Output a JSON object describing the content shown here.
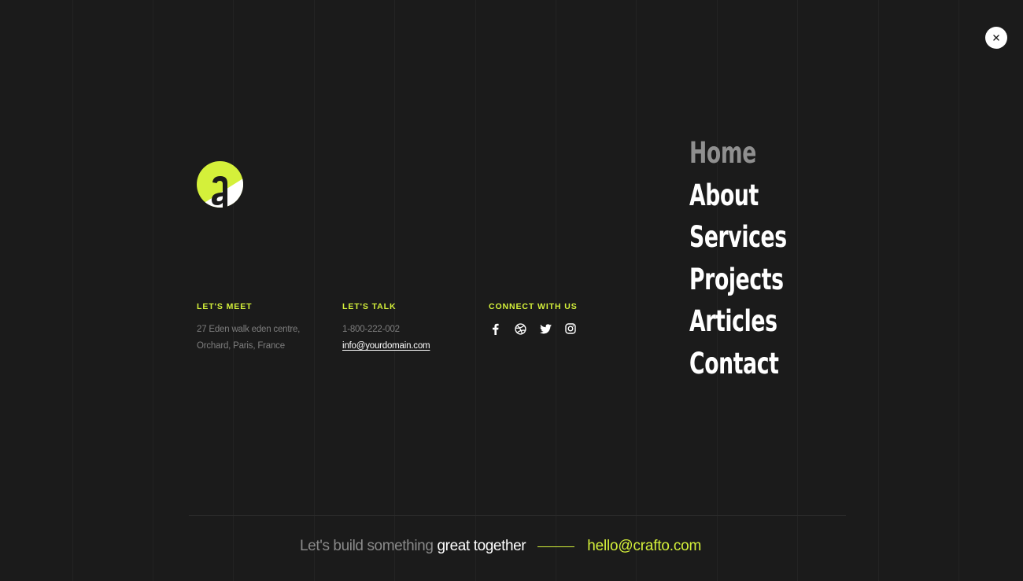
{
  "close": {
    "icon": "close-icon"
  },
  "logo": {
    "icon": "brand-logo-a",
    "letter": "a",
    "accent": "#d4f03a"
  },
  "contact": {
    "meet": {
      "heading": "LET'S MEET",
      "line1": "27 Eden walk eden centre,",
      "line2": "Orchard, Paris, France"
    },
    "talk": {
      "heading": "LET'S TALK",
      "phone": "1-800-222-002",
      "email": "info@yourdomain.com"
    },
    "connect": {
      "heading": "CONNECT WITH US",
      "icons": [
        "facebook-icon",
        "dribbble-icon",
        "twitter-icon",
        "instagram-icon"
      ]
    }
  },
  "menu": {
    "items": [
      {
        "label": "Home",
        "active": true
      },
      {
        "label": "About",
        "active": false
      },
      {
        "label": "Services",
        "active": false
      },
      {
        "label": "Projects",
        "active": false
      },
      {
        "label": "Articles",
        "active": false
      },
      {
        "label": "Contact",
        "active": false
      }
    ]
  },
  "footer": {
    "tagline_muted": "Let's build something",
    "tagline_strong": "great together",
    "email": "hello@crafto.com"
  },
  "colors": {
    "background": "#1b1b1b",
    "accent": "#d4f03a",
    "text": "#ffffff",
    "muted": "#8a8a8a"
  }
}
